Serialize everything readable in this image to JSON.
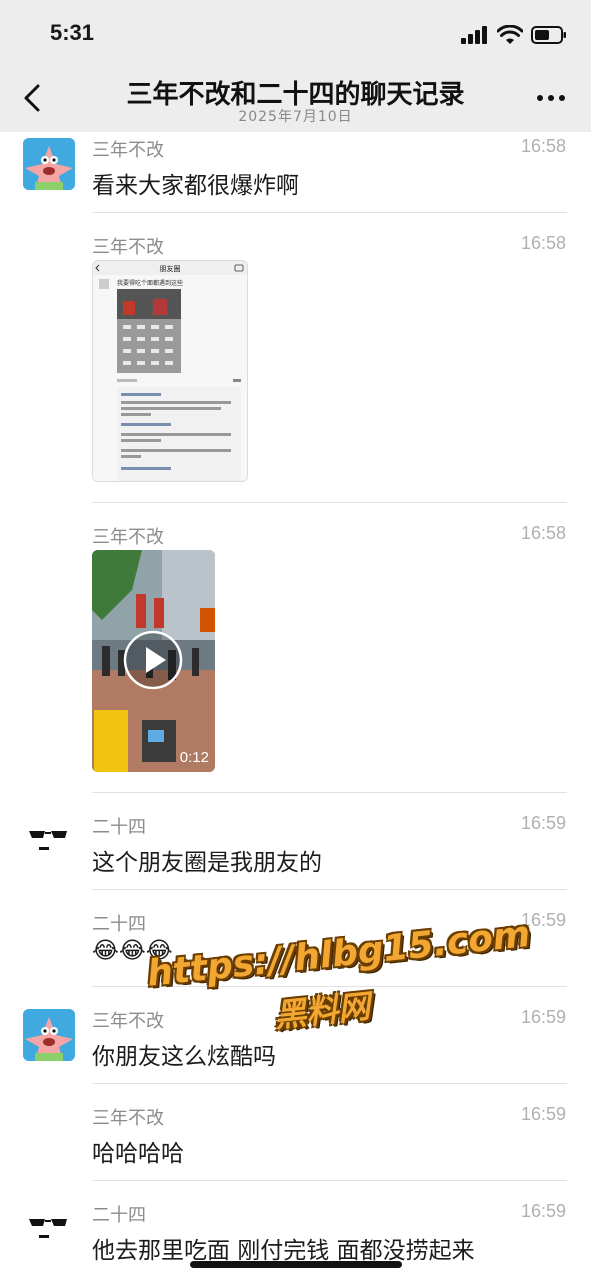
{
  "status_bar": {
    "time": "5:31"
  },
  "header": {
    "title": "三年不改和二十四的聊天记录",
    "date": "2025年7月10日"
  },
  "messages": [
    {
      "sender": "三年不改",
      "time": "16:58",
      "text": "看来大家都很爆炸啊",
      "avatar": "patrick-star-avatar"
    },
    {
      "sender": "三年不改",
      "time": "16:58",
      "image": {
        "header": "朋友圈",
        "caption": "我要得吃个面都遇到这些"
      }
    },
    {
      "sender": "三年不改",
      "time": "16:58",
      "video": {
        "duration": "0:12"
      }
    },
    {
      "sender": "二十四",
      "time": "16:59",
      "text": "这个朋友圈是我朋友的",
      "avatar": "sunglasses-face-avatar"
    },
    {
      "sender": "二十四",
      "time": "16:59",
      "text": "😂😂😂"
    },
    {
      "sender": "三年不改",
      "time": "16:59",
      "text": "你朋友这么炫酷吗",
      "avatar": "patrick-star-avatar"
    },
    {
      "sender": "三年不改",
      "time": "16:59",
      "text": "哈哈哈哈"
    },
    {
      "sender": "二十四",
      "time": "16:59",
      "text": "他去那里吃面 刚付完钱 面都没捞起来",
      "avatar": "sunglasses-face-avatar"
    }
  ],
  "watermark": {
    "url": "https://hlbg15.com",
    "name": "黑料网"
  },
  "colors": {
    "background": "#ffffff",
    "header_bg": "#ededed",
    "watermark": "#f2a732"
  }
}
